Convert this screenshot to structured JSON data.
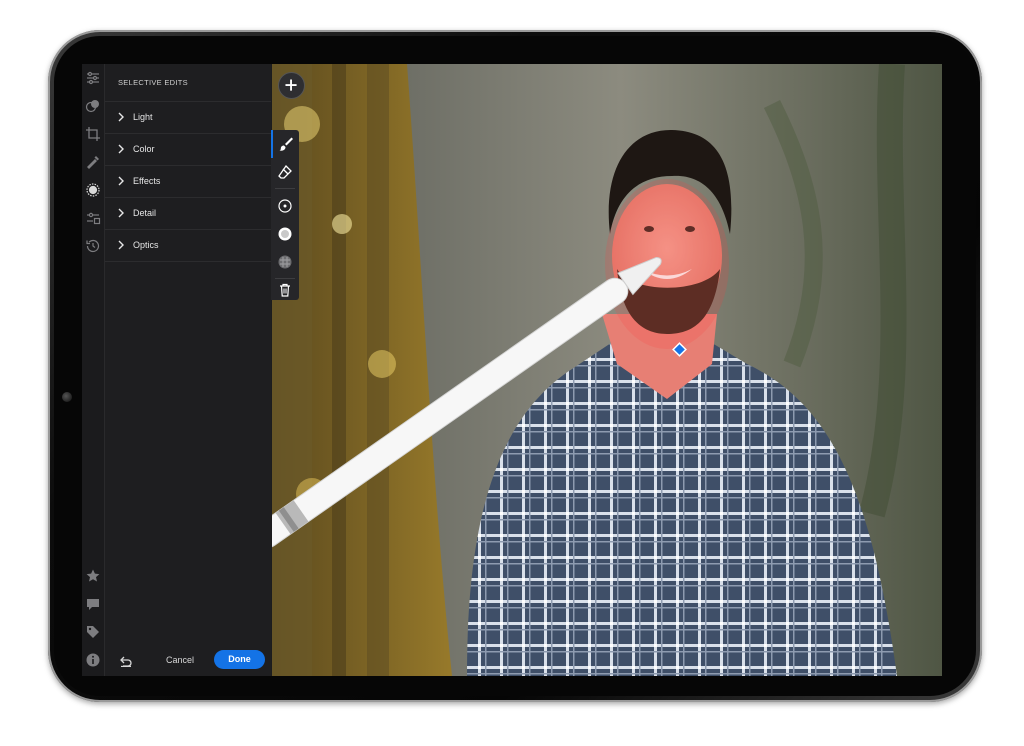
{
  "panel": {
    "title": "SELECTIVE EDITS",
    "sections": [
      {
        "label": "Light"
      },
      {
        "label": "Color"
      },
      {
        "label": "Effects"
      },
      {
        "label": "Detail"
      },
      {
        "label": "Optics"
      }
    ],
    "cancel_label": "Cancel",
    "done_label": "Done"
  },
  "rail_icons": [
    "sliders-icon",
    "presets-icon",
    "crop-icon",
    "healing-icon",
    "selective-icon",
    "geometry-icon",
    "history-icon",
    "star-icon",
    "comment-icon",
    "tag-icon",
    "info-icon"
  ],
  "tools": [
    "brush-icon",
    "eraser-icon",
    "radial-gradient-icon",
    "linear-gradient-icon",
    "mask-overlay-icon",
    "trash-icon"
  ],
  "colors": {
    "accent": "#1473e6",
    "mask_overlay": "#ff3c3c",
    "pin": "#1473e6"
  }
}
